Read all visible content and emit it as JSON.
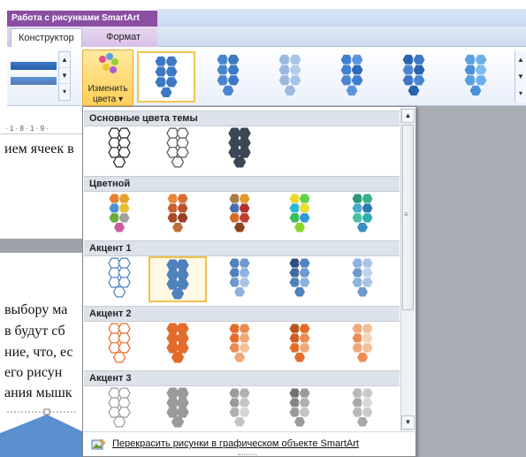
{
  "ribbon": {
    "context_title": "Работа с рисунками SmartArt",
    "tabs": [
      {
        "label": "Конструктор",
        "active": true
      },
      {
        "label": "Формат",
        "active": false
      }
    ],
    "change_colors_label": "Изменить цвета",
    "change_colors_arrow": "▾"
  },
  "document": {
    "ruler": "· 1 · 8 · 1 · 9 ·",
    "lines_top": [
      "ием ячеек в"
    ],
    "lines_bottom": [
      "выбору ма",
      "в будут сб",
      "ние, что, ес",
      "его рисун",
      "ания мышк"
    ]
  },
  "dropdown": {
    "sections": [
      {
        "header": "Основные цвета темы",
        "items": [
          {
            "palette": [
              "#ffffff",
              "#ffffff",
              "#ffffff",
              "#ffffff",
              "#ffffff",
              "#ffffff",
              "#ffffff"
            ],
            "stroke": "#222222"
          },
          {
            "palette": [
              "#ffffff",
              "#ffffff",
              "#ffffff",
              "#ffffff",
              "#ffffff",
              "#ffffff",
              "#ffffff"
            ],
            "stroke": "#555555"
          },
          {
            "palette": [
              "#3b4656",
              "#3b4656",
              "#3b4656",
              "#3b4656",
              "#3b4656",
              "#3b4656",
              "#3b4656"
            ],
            "stroke": "#3b4656"
          }
        ]
      },
      {
        "header": "Цветной",
        "items": [
          {
            "palette": [
              "#e87d2f",
              "#e8a32f",
              "#4a8fd6",
              "#e8c02f",
              "#6caa3b",
              "#a0a0a0",
              "#c85e9c"
            ],
            "stroke": "none"
          },
          {
            "palette": [
              "#e8863a",
              "#d87036",
              "#c86032",
              "#b8542c",
              "#a84828",
              "#983e24",
              "#c0703a"
            ],
            "stroke": "none"
          },
          {
            "palette": [
              "#a87a4a",
              "#e09a2e",
              "#4a6cb0",
              "#b03030",
              "#d86a20",
              "#c04030",
              "#904020"
            ],
            "stroke": "none"
          },
          {
            "palette": [
              "#f0d82a",
              "#5fd24a",
              "#2ab8d8",
              "#e8e02a",
              "#34c05a",
              "#2e9ad8",
              "#8ad82a"
            ],
            "stroke": "none"
          },
          {
            "palette": [
              "#2a9a7a",
              "#34b08a",
              "#4aa8d0",
              "#2a7ab0",
              "#4ac0a0",
              "#2ab0b0",
              "#3a90c0"
            ],
            "stroke": "none"
          }
        ]
      },
      {
        "header": "Акцент 1",
        "items": [
          {
            "palette": [
              "#ffffff",
              "#ffffff",
              "#ffffff",
              "#ffffff",
              "#ffffff",
              "#ffffff",
              "#ffffff"
            ],
            "stroke": "#4f81bd"
          },
          {
            "palette": [
              "#4f81bd",
              "#4f81bd",
              "#4f81bd",
              "#4f81bd",
              "#4f81bd",
              "#4f81bd",
              "#4f81bd"
            ],
            "stroke": "#4f81bd"
          },
          {
            "palette": [
              "#4f81bd",
              "#6f99cc",
              "#4f81bd",
              "#8db2dd",
              "#6f99cc",
              "#a9c4e6",
              "#8db2dd"
            ],
            "stroke": "none"
          },
          {
            "palette": [
              "#2e4f7a",
              "#4f81bd",
              "#3e6aa0",
              "#6f99cc",
              "#4f81bd",
              "#8db2dd",
              "#4f81bd"
            ],
            "stroke": "none"
          },
          {
            "palette": [
              "#8db2dd",
              "#a9c4e6",
              "#6f99cc",
              "#bed3ee",
              "#8db2dd",
              "#a9c4e6",
              "#6f99cc"
            ],
            "stroke": "none"
          }
        ]
      },
      {
        "header": "Акцент 2",
        "items": [
          {
            "palette": [
              "#ffffff",
              "#ffffff",
              "#ffffff",
              "#ffffff",
              "#ffffff",
              "#ffffff",
              "#ffffff"
            ],
            "stroke": "#e36c2a"
          },
          {
            "palette": [
              "#e36c2a",
              "#e36c2a",
              "#e36c2a",
              "#e36c2a",
              "#e36c2a",
              "#e36c2a",
              "#e36c2a"
            ],
            "stroke": "#e36c2a"
          },
          {
            "palette": [
              "#e36c2a",
              "#eb8c52",
              "#e36c2a",
              "#f0a878",
              "#eb8c52",
              "#f5c09c",
              "#f0a878"
            ],
            "stroke": "none"
          },
          {
            "palette": [
              "#b85418",
              "#e36c2a",
              "#cc6020",
              "#eb8c52",
              "#e36c2a",
              "#f0a878",
              "#e36c2a"
            ],
            "stroke": "none"
          },
          {
            "palette": [
              "#f0a878",
              "#f5c09c",
              "#eb8c52",
              "#f8d2b6",
              "#f0a878",
              "#f5c09c",
              "#eb8c52"
            ],
            "stroke": "none"
          }
        ]
      },
      {
        "header": "Акцент 3",
        "items": [
          {
            "palette": [
              "#ffffff",
              "#ffffff",
              "#ffffff",
              "#ffffff",
              "#ffffff",
              "#ffffff",
              "#ffffff"
            ],
            "stroke": "#9a9a9a"
          },
          {
            "palette": [
              "#9a9a9a",
              "#9a9a9a",
              "#9a9a9a",
              "#9a9a9a",
              "#9a9a9a",
              "#9a9a9a",
              "#9a9a9a"
            ],
            "stroke": "#9a9a9a"
          },
          {
            "palette": [
              "#9a9a9a",
              "#b0b0b0",
              "#9a9a9a",
              "#c4c4c4",
              "#b0b0b0",
              "#d4d4d4",
              "#c4c4c4"
            ],
            "stroke": "none"
          },
          {
            "palette": [
              "#707070",
              "#9a9a9a",
              "#858585",
              "#b0b0b0",
              "#9a9a9a",
              "#c4c4c4",
              "#9a9a9a"
            ],
            "stroke": "none"
          },
          {
            "palette": [
              "#b8b8b8",
              "#cacaca",
              "#a8a8a8",
              "#d8d8d8",
              "#b8b8b8",
              "#cacaca",
              "#a8a8a8"
            ],
            "stroke": "none"
          }
        ]
      }
    ],
    "footer_label": "Перекрасить рисунки в графическом объекте SmartArt"
  },
  "colors": {
    "accent_purple": "#8a4fa3",
    "selected_border": "#f0c34d",
    "ribbon_blue": "#4f81bd"
  }
}
